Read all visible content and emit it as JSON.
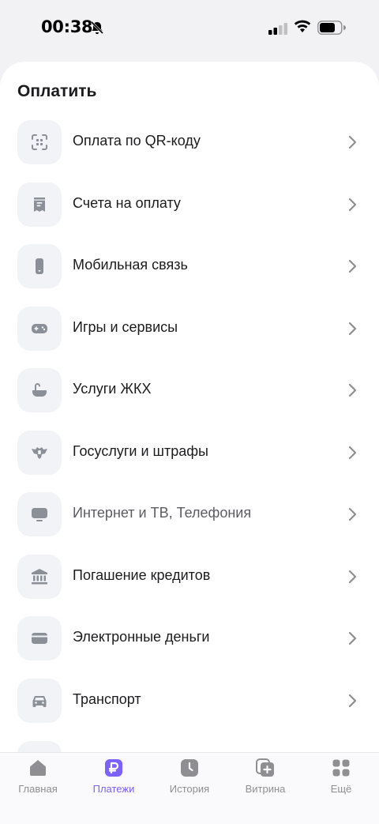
{
  "status_bar": {
    "time": "00:38"
  },
  "header": {
    "title": "Оплатить"
  },
  "menu": {
    "items": [
      {
        "label": "Оплата по QR-коду",
        "icon": "qr-scan-icon"
      },
      {
        "label": "Счета на оплату",
        "icon": "receipt-icon"
      },
      {
        "label": "Мобильная связь",
        "icon": "mobile-phone-icon"
      },
      {
        "label": "Игры и сервисы",
        "icon": "gamepad-icon"
      },
      {
        "label": "Услуги ЖКХ",
        "icon": "bathtub-icon"
      },
      {
        "label": "Госуслуги и штрафы",
        "icon": "coat-of-arms-icon"
      },
      {
        "label": "Интернет и ТВ, Телефония",
        "icon": "tv-icon"
      },
      {
        "label": "Погашение кредитов",
        "icon": "bank-icon"
      },
      {
        "label": "Электронные деньги",
        "icon": "wallet-icon"
      },
      {
        "label": "Транспорт",
        "icon": "car-icon"
      }
    ]
  },
  "tab_bar": {
    "tabs": [
      {
        "label": "Главная",
        "icon": "home-icon"
      },
      {
        "label": "Платежи",
        "icon": "ruble-icon",
        "active": true
      },
      {
        "label": "История",
        "icon": "clock-icon"
      },
      {
        "label": "Витрина",
        "icon": "showcase-icon"
      },
      {
        "label": "Ещё",
        "icon": "grid-icon"
      }
    ]
  },
  "colors": {
    "accent": "#7b61ff",
    "icon_gray": "#8a8f98",
    "tile_bg": "#f2f3f6"
  }
}
